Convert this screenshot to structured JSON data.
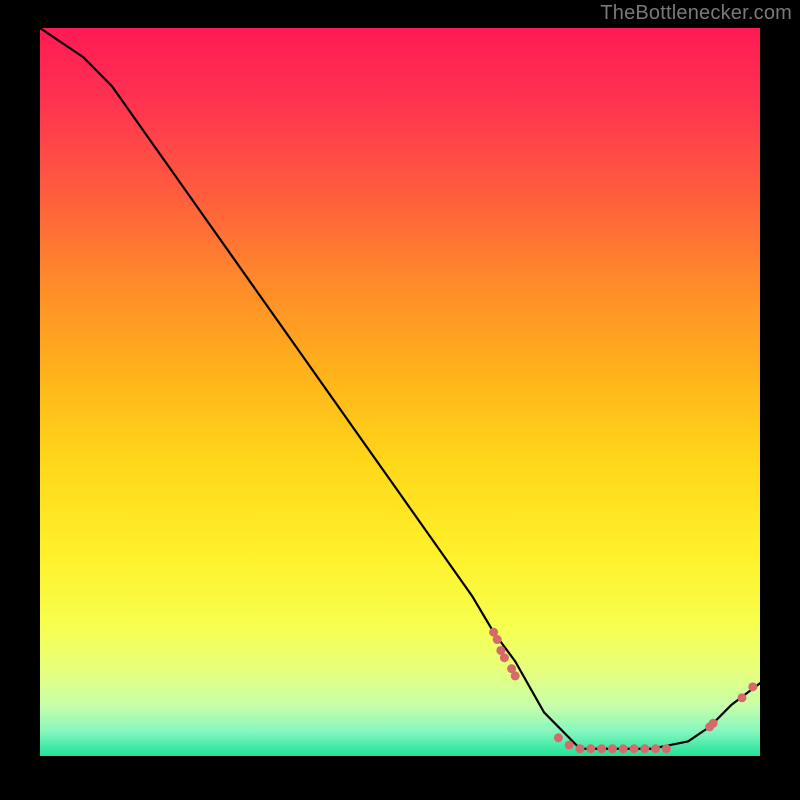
{
  "attribution": "TheBottlenecker.com",
  "colors": {
    "background": "#000000",
    "line": "#000000",
    "marker": "#d66a6a",
    "gradient_stops": [
      {
        "t": 0.0,
        "c": "#ff1a55"
      },
      {
        "t": 0.1,
        "c": "#ff3350"
      },
      {
        "t": 0.22,
        "c": "#ff5a3f"
      },
      {
        "t": 0.35,
        "c": "#ff8a2a"
      },
      {
        "t": 0.48,
        "c": "#ffb41a"
      },
      {
        "t": 0.6,
        "c": "#ffd81a"
      },
      {
        "t": 0.72,
        "c": "#fff02a"
      },
      {
        "t": 0.82,
        "c": "#f7ff4d"
      },
      {
        "t": 0.88,
        "c": "#e8ff7a"
      },
      {
        "t": 0.93,
        "c": "#c8ffa8"
      },
      {
        "t": 0.965,
        "c": "#88f7bf"
      },
      {
        "t": 1.0,
        "c": "#1ee39a"
      }
    ]
  },
  "chart_data": {
    "type": "line",
    "title": "",
    "xlabel": "",
    "ylabel": "",
    "xlim": [
      0,
      100
    ],
    "ylim": [
      0,
      100
    ],
    "x": [
      0,
      6,
      10,
      15,
      20,
      25,
      30,
      35,
      40,
      45,
      50,
      55,
      60,
      63,
      66,
      70,
      75,
      80,
      85,
      90,
      93,
      96,
      100
    ],
    "y": [
      100,
      96,
      92,
      85,
      78,
      71,
      64,
      57,
      50,
      43,
      36,
      29,
      22,
      17,
      13,
      6,
      1,
      1,
      1,
      2,
      4,
      7,
      10
    ],
    "markers": [
      {
        "x": 63.0,
        "y": 17.0
      },
      {
        "x": 63.5,
        "y": 16.0
      },
      {
        "x": 64.0,
        "y": 14.5
      },
      {
        "x": 64.5,
        "y": 13.5
      },
      {
        "x": 65.5,
        "y": 12.0
      },
      {
        "x": 66.0,
        "y": 11.0
      },
      {
        "x": 72.0,
        "y": 2.5
      },
      {
        "x": 73.5,
        "y": 1.5
      },
      {
        "x": 75.0,
        "y": 1.0
      },
      {
        "x": 76.5,
        "y": 1.0
      },
      {
        "x": 78.0,
        "y": 1.0
      },
      {
        "x": 79.5,
        "y": 1.0
      },
      {
        "x": 81.0,
        "y": 1.0
      },
      {
        "x": 82.5,
        "y": 1.0
      },
      {
        "x": 84.0,
        "y": 1.0
      },
      {
        "x": 85.5,
        "y": 1.0
      },
      {
        "x": 87.0,
        "y": 1.0
      },
      {
        "x": 93.0,
        "y": 4.0
      },
      {
        "x": 93.5,
        "y": 4.5
      },
      {
        "x": 97.5,
        "y": 8.0
      },
      {
        "x": 99.0,
        "y": 9.5
      }
    ]
  }
}
